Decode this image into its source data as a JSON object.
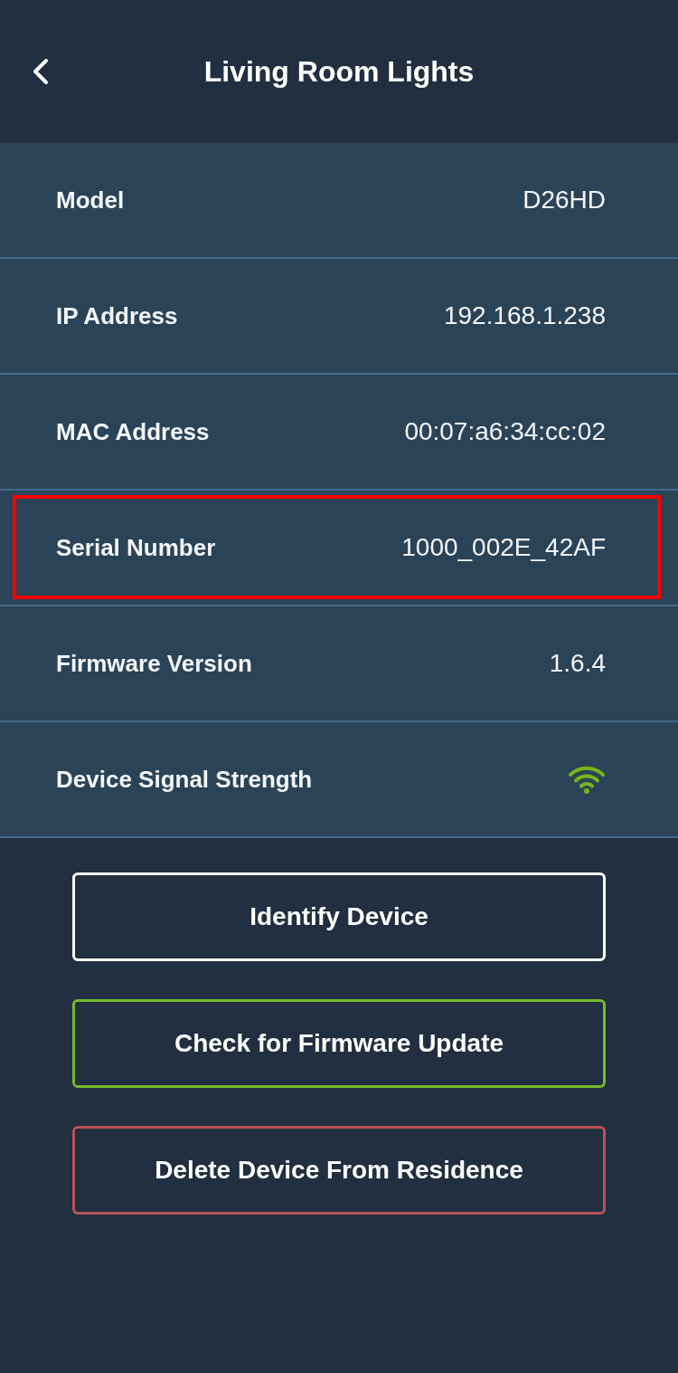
{
  "header": {
    "title": "Living Room Lights"
  },
  "details": [
    {
      "kind": "text",
      "label": "Model",
      "value": "D26HD",
      "highlighted": false
    },
    {
      "kind": "text",
      "label": "IP Address",
      "value": "192.168.1.238",
      "highlighted": false
    },
    {
      "kind": "text",
      "label": "MAC Address",
      "value": "00:07:a6:34:cc:02",
      "highlighted": false
    },
    {
      "kind": "text",
      "label": "Serial Number",
      "value": "1000_002E_42AF",
      "highlighted": true
    },
    {
      "kind": "text",
      "label": "Firmware Version",
      "value": "1.6.4",
      "highlighted": false
    },
    {
      "kind": "signal",
      "label": "Device Signal Strength",
      "highlighted": false
    }
  ],
  "actions": [
    {
      "kind": "neutral",
      "label": "Identify Device"
    },
    {
      "kind": "update",
      "label": "Check for Firmware Update"
    },
    {
      "kind": "danger",
      "label": "Delete Device From Residence"
    }
  ]
}
